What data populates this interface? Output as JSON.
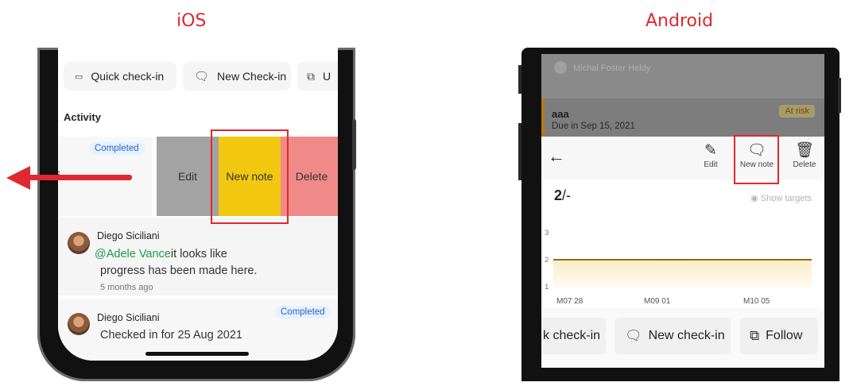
{
  "labels": {
    "ios": "iOS",
    "android": "Android"
  },
  "ios": {
    "chips": [
      {
        "label": "Quick check-in",
        "icon": "number-pad-icon"
      },
      {
        "label": "New Check-in",
        "icon": "chat-add-icon"
      },
      {
        "label": "U",
        "icon": "follow-icon"
      }
    ],
    "activity_title": "Activity",
    "card1": {
      "badge": "Completed",
      "partial_text": "s"
    },
    "swipe_actions": {
      "edit": "Edit",
      "new_note": "New note",
      "delete": "Delete"
    },
    "comment": {
      "author": "Diego Siciliani",
      "mention": "@Adele Vance",
      "text_line1": "it looks like",
      "text_line2": "progress has been made here.",
      "time": "5 months ago"
    },
    "checkin": {
      "author": "Diego Siciliani",
      "badge": "Completed",
      "text": "Checked in for 25 Aug 2021"
    }
  },
  "android": {
    "dim_person": "Michal Foster Heldy",
    "dim_item": {
      "title": "aaa",
      "due": "Due in Sep 15, 2021",
      "status": "At risk"
    },
    "toolbar": {
      "edit": "Edit",
      "new_note": "New note",
      "delete": "Delete"
    },
    "value": {
      "main": "2",
      "suffix": "/-"
    },
    "show_targets": "Show targets",
    "buttons": {
      "quick_checkin": "k check-in",
      "new_checkin": "New check-in",
      "follow": "Follow"
    }
  },
  "chart_data": {
    "type": "area",
    "x": [
      "M07 28",
      "M09 01",
      "M10 05"
    ],
    "series": [
      {
        "values": [
          2,
          2,
          2
        ]
      }
    ],
    "y_ticks": [
      1,
      2,
      3
    ],
    "ylim": [
      1,
      3
    ],
    "grid": false
  },
  "colors": {
    "highlight": "#e0282e",
    "swipe_edit": "#a3a3a3",
    "swipe_new_note": "#f2c811",
    "swipe_delete": "#f08a88",
    "mention": "#1e9a4a"
  }
}
